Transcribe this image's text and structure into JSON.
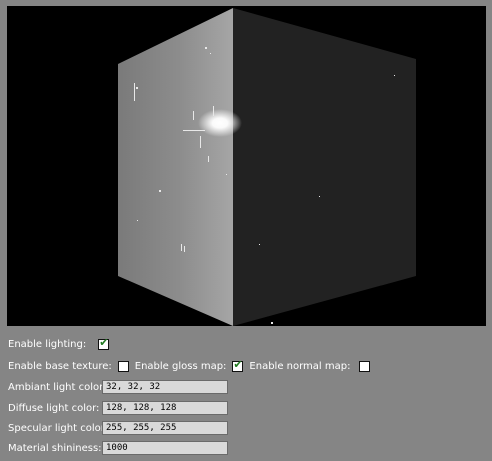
{
  "controls": {
    "enable_lighting": {
      "label": "Enable lighting:",
      "checked": true
    },
    "enable_base_texture": {
      "label": "Enable base texture:",
      "checked": false
    },
    "enable_gloss_map": {
      "label": "Enable gloss map:",
      "checked": true
    },
    "enable_normal_map": {
      "label": "Enable normal map:",
      "checked": false
    },
    "ambient_light_color": {
      "label": "Ambiant light color:",
      "value": "32, 32, 32"
    },
    "diffuse_light_color": {
      "label": "Diffuse light color:",
      "value": "128, 128, 128"
    },
    "specular_light_color": {
      "label": "Specular light color:",
      "value": "255, 255, 255"
    },
    "material_shininess": {
      "label": "Material shininess:",
      "value": "1000"
    }
  },
  "colors": {
    "panel_background": "#858585",
    "viewport_background": "#000000",
    "checkmark": "#1f7a1f"
  }
}
